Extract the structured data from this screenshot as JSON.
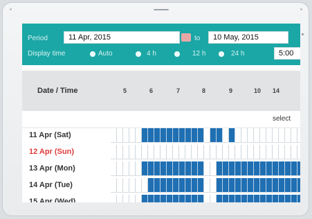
{
  "header": {
    "period_label": "Period",
    "period_start": "11 Apr, 2015",
    "to_label": "to",
    "period_end": "10 May, 2015",
    "display_time_label": "Display time",
    "display_options": [
      "Auto",
      "4 h",
      "12 h",
      "24 h"
    ],
    "time_value": "5:00"
  },
  "table": {
    "date_time_label": "Date / Time",
    "hours": [
      "5",
      "6",
      "7",
      "8",
      "9",
      "10",
      "14"
    ],
    "select_label": "select",
    "rows": [
      {
        "label": "11 Apr (Sat)",
        "sunday": false,
        "slots": "0000011111111110110100000000000"
      },
      {
        "label": "12 Apr (Sun)",
        "sunday": true,
        "slots": "0000000000000000000000000000000"
      },
      {
        "label": "13 Apr (Mon)",
        "sunday": false,
        "slots": "0000011111111110011111111111111"
      },
      {
        "label": "14 Apr (Tue)",
        "sunday": false,
        "slots": "0000001111111110011111111111111"
      },
      {
        "label": "15 Apr (Wed)",
        "sunday": false,
        "slots": "0000011111111110011111111111111"
      }
    ]
  },
  "colors": {
    "header": "#1aa7a6",
    "slot_on": "#1f6fb3",
    "sunday": "#e03a3a"
  }
}
